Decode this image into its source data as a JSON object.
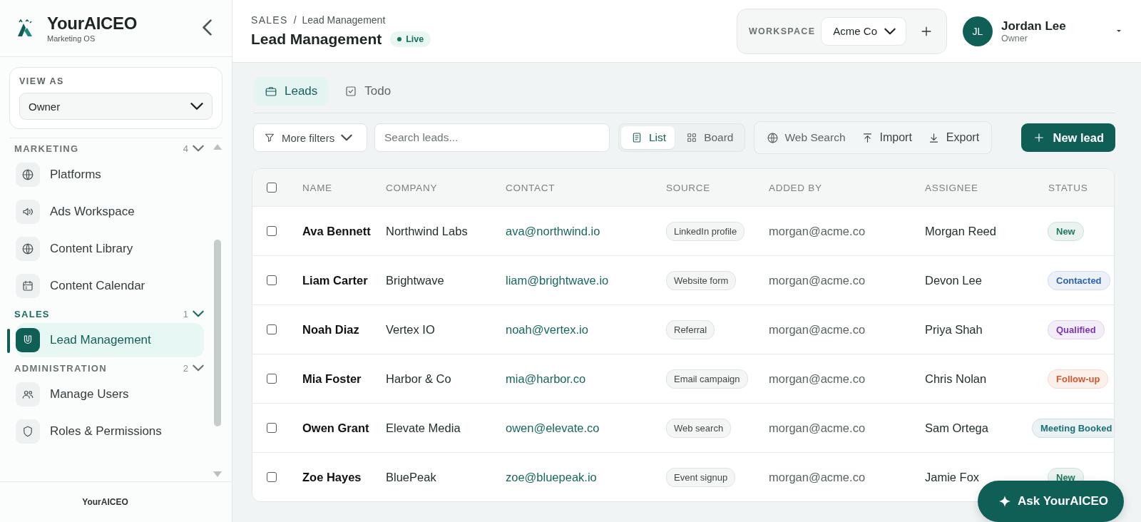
{
  "brand": {
    "name": "YourAICEO",
    "subtitle": "Marketing OS"
  },
  "view_as": {
    "label": "VIEW AS",
    "value": "Owner"
  },
  "nav_sections": [
    {
      "title": "MARKETING",
      "count": "4",
      "selected": false,
      "items": [
        {
          "label": "Platforms",
          "kind": "globe",
          "selected": false
        },
        {
          "label": "Ads Workspace",
          "kind": "speaker",
          "selected": false
        },
        {
          "label": "Content Library",
          "kind": "globe",
          "selected": false
        },
        {
          "label": "Content Calendar",
          "kind": "calendar",
          "selected": false
        }
      ]
    },
    {
      "title": "SALES",
      "count": "1",
      "selected": true,
      "items": [
        {
          "label": "Lead Management",
          "kind": "magnet",
          "selected": true
        }
      ]
    },
    {
      "title": "ADMINISTRATION",
      "count": "2",
      "selected": false,
      "items": [
        {
          "label": "Manage Users",
          "kind": "users",
          "selected": false
        },
        {
          "label": "Roles & Permissions",
          "kind": "shield",
          "selected": false
        }
      ]
    }
  ],
  "sidebar_footer": "YourAICEO",
  "breadcrumb": {
    "section": "SALES",
    "separator": "/",
    "page": "Lead Management"
  },
  "page_title": "Lead Management",
  "status_badge": "Live",
  "workspace": {
    "label": "WORKSPACE",
    "value": "Acme Co"
  },
  "user": {
    "initials": "JL",
    "name": "Jordan Lee",
    "role": "Owner"
  },
  "tabs": [
    {
      "label": "Leads",
      "kind": "briefcase",
      "selected": true
    },
    {
      "label": "Todo",
      "kind": "checkbox",
      "selected": false
    }
  ],
  "toolbar": {
    "filter": "More filters",
    "search_placeholder": "Search leads...",
    "views": [
      {
        "label": "List",
        "kind": "list",
        "selected": true
      },
      {
        "label": "Board",
        "kind": "grid",
        "selected": false
      }
    ],
    "actions": [
      {
        "label": "Web Search",
        "kind": "globe"
      },
      {
        "label": "Import",
        "kind": "upload"
      },
      {
        "label": "Export",
        "kind": "download"
      }
    ],
    "primary": "New lead"
  },
  "table": {
    "select_all_checked": false,
    "columns": [
      "NAME",
      "COMPANY",
      "CONTACT",
      "SOURCE",
      "ADDED BY",
      "ASSIGNEE",
      "STATUS"
    ],
    "rows": [
      {
        "checked": false,
        "name": "Ava Bennett",
        "company": "Northwind Labs",
        "contact": "ava@northwind.io",
        "source": "LinkedIn profile",
        "added_by": "morgan@acme.co",
        "assignee": "Morgan Reed",
        "status": {
          "label": "New",
          "color": "#1f7a5c"
        }
      },
      {
        "checked": false,
        "name": "Liam Carter",
        "company": "Brightwave",
        "contact": "liam@brightwave.io",
        "source": "Website form",
        "added_by": "morgan@acme.co",
        "assignee": "Devon Lee",
        "status": {
          "label": "Contacted",
          "color": "#2d63b5"
        }
      },
      {
        "checked": false,
        "name": "Noah Diaz",
        "company": "Vertex IO",
        "contact": "noah@vertex.io",
        "source": "Referral",
        "added_by": "morgan@acme.co",
        "assignee": "Priya Shah",
        "status": {
          "label": "Qualified",
          "color": "#7a35b8"
        }
      },
      {
        "checked": false,
        "name": "Mia Foster",
        "company": "Harbor & Co",
        "contact": "mia@harbor.co",
        "source": "Email campaign",
        "added_by": "morgan@acme.co",
        "assignee": "Chris Nolan",
        "status": {
          "label": "Follow-up",
          "color": "#d0582a"
        }
      },
      {
        "checked": false,
        "name": "Owen Grant",
        "company": "Elevate Media",
        "contact": "owen@elevate.co",
        "source": "Web search",
        "added_by": "morgan@acme.co",
        "assignee": "Sam Ortega",
        "status": {
          "label": "Meeting Booked",
          "color": "#1b6f78"
        }
      },
      {
        "checked": false,
        "name": "Zoe Hayes",
        "company": "BluePeak",
        "contact": "zoe@bluepeak.io",
        "source": "Event signup",
        "added_by": "morgan@acme.co",
        "assignee": "Jamie Fox",
        "status": {
          "label": "New",
          "color": "#1f7a5c"
        }
      }
    ]
  },
  "ask_button": "Ask YourAICEO"
}
